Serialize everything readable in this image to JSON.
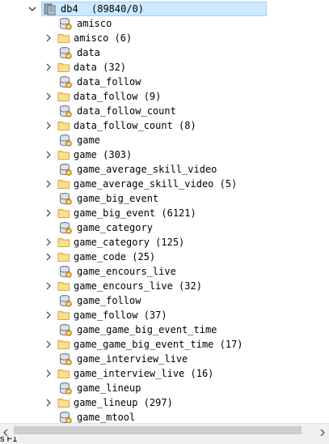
{
  "colors": {
    "selection_bg": "#cde8ff",
    "selection_border": "#99d1ff",
    "folder": "#f6c85a",
    "db": "#7a8797",
    "view_badge": "#f0a030"
  },
  "database": {
    "name": "db4",
    "stats": "(89840/0)",
    "icon": "database-icon",
    "expanded": true
  },
  "tree_items": [
    {
      "label": "amisco",
      "kind": "view"
    },
    {
      "label": "amisco (6)",
      "kind": "folder"
    },
    {
      "label": "data",
      "kind": "view"
    },
    {
      "label": "data (32)",
      "kind": "folder"
    },
    {
      "label": "data_follow",
      "kind": "view"
    },
    {
      "label": "data_follow (9)",
      "kind": "folder"
    },
    {
      "label": "data_follow_count",
      "kind": "view"
    },
    {
      "label": "data_follow_count (8)",
      "kind": "folder"
    },
    {
      "label": "game",
      "kind": "view"
    },
    {
      "label": "game (303)",
      "kind": "folder"
    },
    {
      "label": "game_average_skill_video",
      "kind": "view"
    },
    {
      "label": "game_average_skill_video (5)",
      "kind": "folder"
    },
    {
      "label": "game_big_event",
      "kind": "view"
    },
    {
      "label": "game_big_event (6121)",
      "kind": "folder"
    },
    {
      "label": "game_category",
      "kind": "view"
    },
    {
      "label": "game_category (125)",
      "kind": "folder"
    },
    {
      "label": "game_code (25)",
      "kind": "folder"
    },
    {
      "label": "game_encours_live",
      "kind": "view"
    },
    {
      "label": "game_encours_live (32)",
      "kind": "folder"
    },
    {
      "label": "game_follow",
      "kind": "view"
    },
    {
      "label": "game_follow (37)",
      "kind": "folder"
    },
    {
      "label": "game_game_big_event_time",
      "kind": "view"
    },
    {
      "label": "game_game_big_event_time (17)",
      "kind": "folder"
    },
    {
      "label": "game_interview_live",
      "kind": "view"
    },
    {
      "label": "game_interview_live (16)",
      "kind": "folder"
    },
    {
      "label": "game_lineup",
      "kind": "view"
    },
    {
      "label": "game_lineup (297)",
      "kind": "folder"
    },
    {
      "label": "game_mtool",
      "kind": "view"
    }
  ],
  "statusbar": {
    "text": "s F1"
  }
}
